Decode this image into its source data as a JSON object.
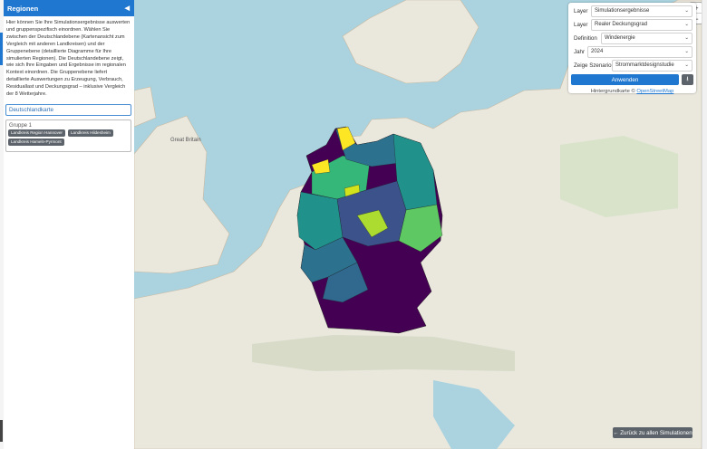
{
  "sidebar": {
    "title": "Regionen",
    "description": "Hier können Sie Ihre Simulationsergebnisse auswerten und gruppenspezifisch einordnen. Wählen Sie zwischen der Deutschlandebene (Kartenansicht zum Vergleich mit anderen Landkreisen) und der Gruppenebene (detaillierte Diagramme für Ihre simulierten Regionen). Die Deutschlandebene zeigt, wie sich Ihre Eingaben und Ergebnisse im regionalen Kontext einordnen. Die Gruppenebene liefert detaillierte Auswertungen zu Erzeugung, Verbrauch, Residuallast und Deckungsgrad – inklusive Vergleich der 8 Wetterjahre.",
    "map_view_label": "Deutschlandkarte",
    "group": {
      "title": "Gruppe 1",
      "chips": [
        "Landkreis Region Hannover",
        "Landkreis Hildesheim",
        "Landkreis Hameln-Pyrmont"
      ]
    }
  },
  "map_controls": {
    "zoom_in": "+",
    "zoom_out": "−"
  },
  "panel": {
    "layer1_label": "Layer",
    "layer1_value": "Simulationsergebnisse",
    "layer2_label": "Layer",
    "layer2_value": "Realer Deckungsgrad",
    "definition_label": "Definition",
    "definition_value": "Windenergie",
    "year_label": "Jahr",
    "year_value": "2024",
    "scenario_label": "Zeige Szenario",
    "scenario_value": "Strommarktdesignstudie",
    "apply_label": "Anwenden",
    "download_icon": "⭳",
    "attribution_prefix": "Hintergrundkarte ©",
    "attribution_link": "OpenStreetMap"
  },
  "back_button": "← Zurück zu allen Simulationen",
  "colors": {
    "accent": "#1f77d0",
    "water": "#aad3df",
    "land": "#eae7dd",
    "choropleth_low": "#440154",
    "choropleth_mid": "#21918c",
    "choropleth_high": "#fde725"
  }
}
